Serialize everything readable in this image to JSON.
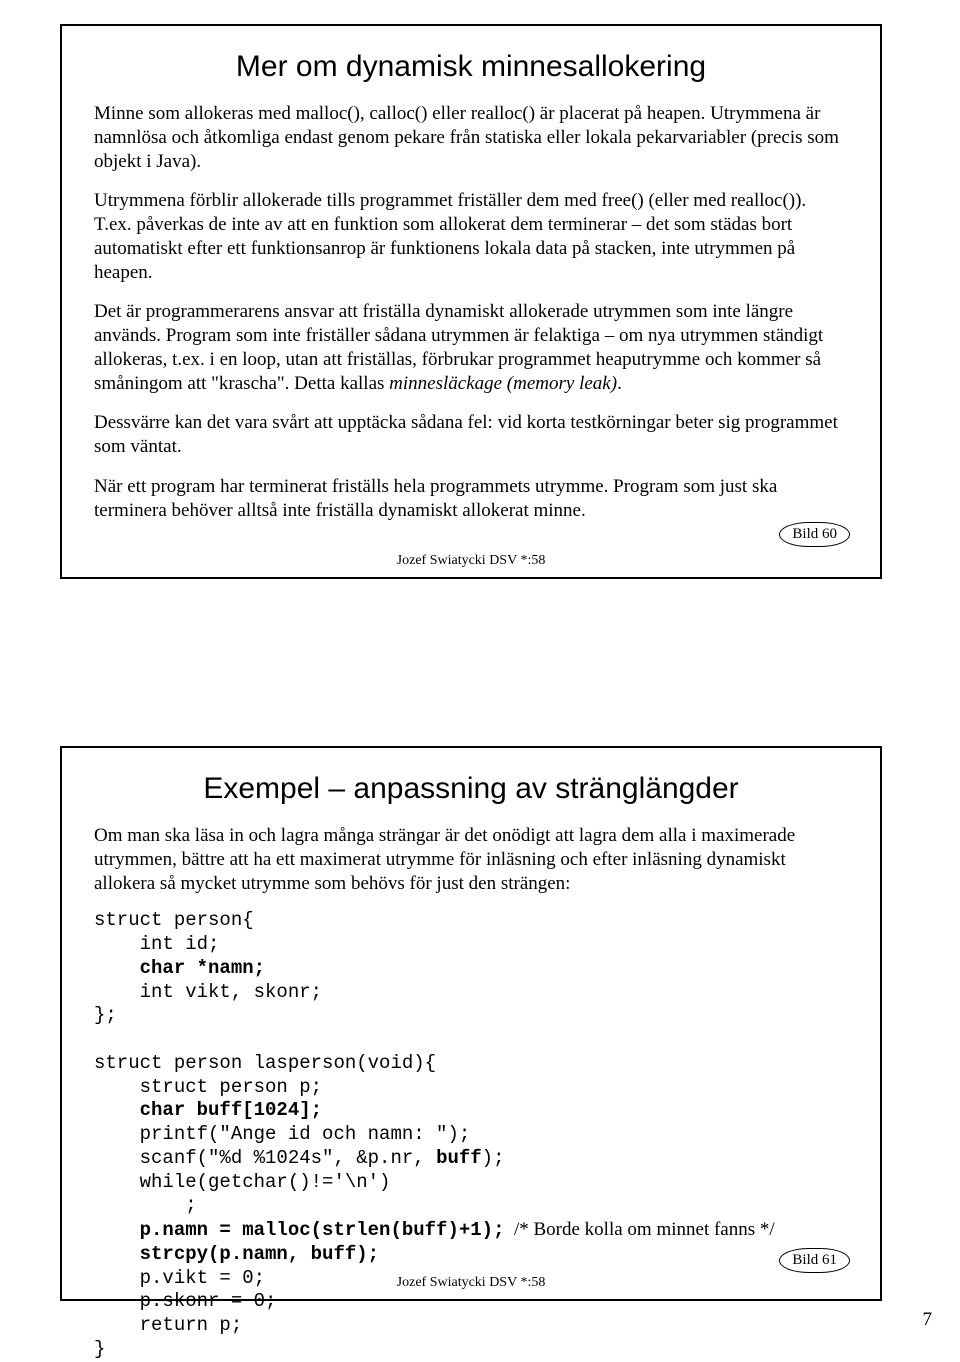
{
  "slide1": {
    "title": "Mer om dynamisk minnesallokering",
    "p1": "Minne som allokeras med malloc(), calloc() eller realloc() är placerat på heapen. Utrymmena är namnlösa och åtkomliga endast genom pekare från statiska eller lokala pekarvariabler (precis som objekt i Java).",
    "p2": "Utrymmena förblir allokerade tills programmet friställer dem med free() (eller med realloc()). T.ex. påverkas de inte av att en funktion som allokerat dem terminerar – det som städas bort automatiskt efter ett funktionsanrop är funktionens lokala data på stacken, inte utrymmen på heapen.",
    "p3a": "Det är programmerarens ansvar att friställa dynamiskt allokerade utrymmen som inte längre används. Program som inte friställer sådana utrymmen är felaktiga – om nya utrymmen ständigt allokeras, t.ex. i en loop, utan att friställas, förbrukar programmet heaputrymme och kommer så småningom att \"krascha\". Detta kallas ",
    "p3i": "minnesläckage (memory leak)",
    "p3b": ".",
    "p4": "Dessvärre kan det vara svårt att upptäcka sådana fel: vid korta testkörningar beter sig programmet som väntat.",
    "p5": "När ett program har terminerat friställs hela programmets utrymme. Program som just ska terminera behöver alltså inte friställa dynamiskt allokerat minne.",
    "footer": "Jozef Swiatycki DSV *:58",
    "badge": "Bild 60"
  },
  "slide2": {
    "title": "Exempel – anpassning av stränglängder",
    "intro": "Om man ska läsa in och lagra många strängar är det onödigt att lagra dem alla i maximerade utrymmen, bättre att ha ett maximerat utrymme för inläsning och efter inläsning dynamiskt allokera så mycket utrymme som behövs för just den strängen:",
    "c1_l1": "struct person{",
    "c1_l2": "    int id;",
    "c1_l3": "    char *namn;",
    "c1_l4": "    int vikt, skonr;",
    "c1_l5": "};",
    "c2_l1": "struct person lasperson(void){",
    "c2_l2": "    struct person p;",
    "c2_l3": "    char buff[1024];",
    "c2_l4": "    printf(\"Ange id och namn: \");",
    "c2_l5a": "    scanf(\"%d %1024s\", &p.nr, ",
    "c2_l5b": "buff",
    "c2_l5c": ");",
    "c2_l6": "    while(getchar()!='\\n')",
    "c2_l7": "        ;",
    "c2_l8a": "    p.namn = malloc(strlen(buff)+1);",
    "c2_l8cmt": "  /* Borde kolla om minnet fanns */",
    "c2_l9": "    strcpy(p.namn, buff);",
    "c2_l10": "    p.vikt = 0;",
    "c2_l11": "    p.skonr = 0;",
    "c2_l12": "    return p;",
    "c2_l13": "}",
    "footer": "Jozef Swiatycki DSV *:58",
    "badge": "Bild 61"
  },
  "pageNumber": "7"
}
